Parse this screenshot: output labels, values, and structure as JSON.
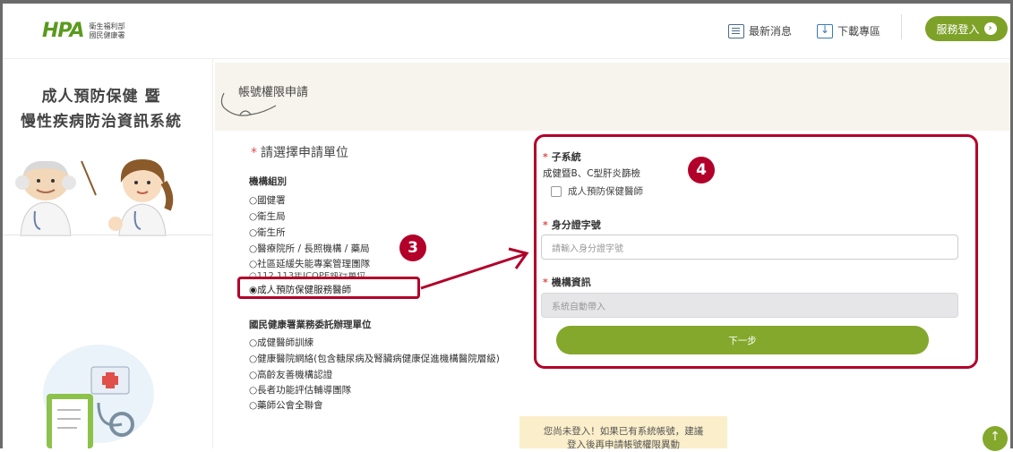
{
  "header": {
    "logo_mark": "HPA",
    "logo_sub_line1": "衛生福利部",
    "logo_sub_line2": "國民健康署",
    "nav": {
      "news_label": "最新消息",
      "download_label": "下載專區"
    },
    "login_label": "服務登入",
    "login_arrow": "›"
  },
  "sidebar": {
    "title_line1": "成人預防保健 暨",
    "title_line2": "慢性疾病防治資訊系統"
  },
  "page": {
    "title": "帳號權限申請"
  },
  "unit_selection": {
    "required_mark": "*",
    "title": "請選擇申請單位",
    "group1": {
      "title": "機構組別",
      "options": [
        {
          "label": "○國健署"
        },
        {
          "label": "○衛生局"
        },
        {
          "label": "○衛生所"
        },
        {
          "label": "○醫療院所 / 長照機構 / 藥局"
        },
        {
          "label": "○社區延緩失能專案管理團隊"
        },
        {
          "label": "○112,113年ICOPE執行單位"
        },
        {
          "label": "◉成人預防保健服務醫師"
        }
      ]
    },
    "group2": {
      "title": "國民健康署業務委託辦理單位",
      "options": [
        {
          "label": "○成健醫師訓練"
        },
        {
          "label": "○健康醫院網絡(包含糖尿病及腎臟病健康促進機構醫院層級)"
        },
        {
          "label": "○高齡友善機構認證"
        },
        {
          "label": "○長者功能評估輔導團隊"
        },
        {
          "label": "○藥師公會全聯會"
        }
      ]
    }
  },
  "annotations": {
    "badge3": "3",
    "badge4": "4"
  },
  "form": {
    "required_mark": "*",
    "subsystem_label": "子系統",
    "subsystem_text": "成健暨B、C型肝炎篩檢",
    "subsystem_checkbox": "成人預防保健醫師",
    "id_label": "身分證字號",
    "id_placeholder": "請輸入身分證字號",
    "org_label": "機構資訊",
    "org_placeholder": "系統自動帶入",
    "next_label": "下一步"
  },
  "notice": {
    "line1": "您尚未登入！如果已有系統帳號，建議",
    "line2": "登入後再申請帳號權限異動"
  },
  "scroll_top": "↑",
  "colors": {
    "brand_green": "#84a82c",
    "highlight_red": "#b2002a",
    "band_beige": "#f6f4ec",
    "notice_yellow": "#fbeeca"
  }
}
